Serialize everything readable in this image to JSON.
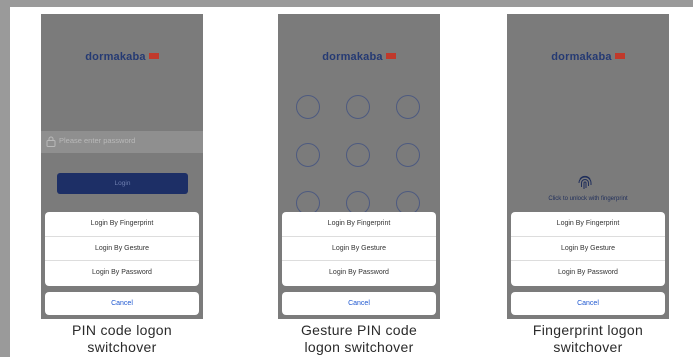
{
  "brand": {
    "name": "dormakaba"
  },
  "colors": {
    "accent": "#1d2f66",
    "link": "#1e57d0",
    "brand_mark": "#c0392b"
  },
  "panels": [
    {
      "password_placeholder": "Please enter password",
      "login_label": "Login",
      "sheet_items": [
        "Login By Fingerprint",
        "Login By Gesture",
        "Login By Password"
      ],
      "cancel_label": "Cancel",
      "caption_line1": "PIN code logon",
      "caption_line2": "switchover"
    },
    {
      "sheet_items": [
        "Login By Fingerprint",
        "Login By Gesture",
        "Login By Password"
      ],
      "cancel_label": "Cancel",
      "caption_line1": "Gesture PIN code",
      "caption_line2": "logon switchover"
    },
    {
      "fingerprint_text": "Click to unlock with fingerprint",
      "sheet_items": [
        "Login By Fingerprint",
        "Login By Gesture",
        "Login By Password"
      ],
      "cancel_label": "Cancel",
      "caption_line1": "Fingerprint logon",
      "caption_line2": "switchover"
    }
  ]
}
